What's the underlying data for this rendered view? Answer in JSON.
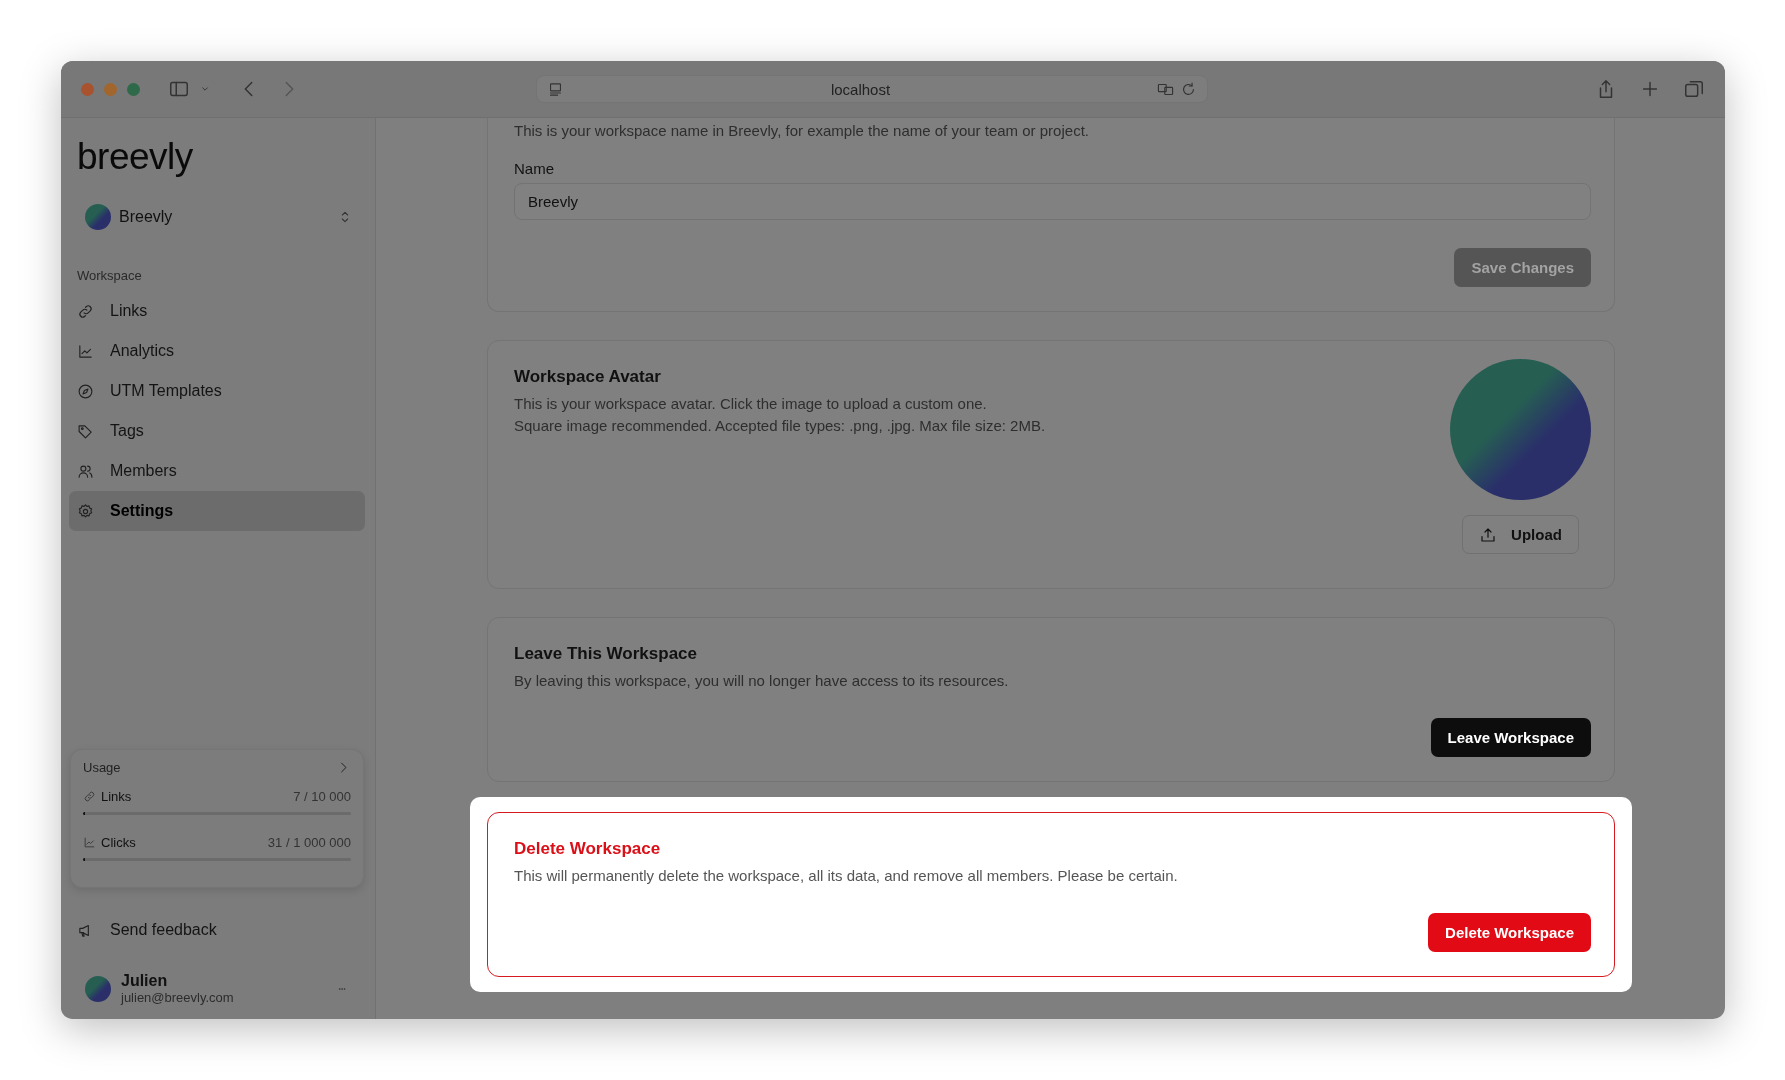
{
  "browser": {
    "url": "localhost"
  },
  "sidebar": {
    "logo": "breevly",
    "workspace": {
      "name": "Breevly"
    },
    "section_label": "Workspace",
    "items": [
      {
        "label": "Links",
        "selected": false
      },
      {
        "label": "Analytics",
        "selected": false
      },
      {
        "label": "UTM Templates",
        "selected": false
      },
      {
        "label": "Tags",
        "selected": false
      },
      {
        "label": "Members",
        "selected": false
      },
      {
        "label": "Settings",
        "selected": true
      }
    ],
    "usage": {
      "title": "Usage",
      "meters": [
        {
          "label": "Links",
          "reading": "7 / 10 000",
          "level": 0.0007
        },
        {
          "label": "Clicks",
          "reading": "31 / 1 000 000",
          "level": 3e-05
        }
      ]
    },
    "feedback": {
      "label": "Send feedback"
    },
    "user": {
      "name": "Julien",
      "email": "julien@breevly.com"
    }
  },
  "main": {
    "cards": [
      {
        "kind": "name_form",
        "highlighted": false,
        "description": "This is your workspace name in Breevly, for example the name of your team or project.",
        "field_label": "Name",
        "value": "Breevly",
        "button": {
          "label": "Save Changes",
          "disabled": true
        }
      },
      {
        "kind": "avatar",
        "highlighted": false,
        "title": "Workspace Avatar",
        "description_lines": [
          "This is your workspace avatar. Click the image to upload a custom one.",
          "Square image recommended. Accepted file types: .png, .jpg. Max file size: 2MB."
        ],
        "button": {
          "label": "Upload",
          "disabled": false
        }
      },
      {
        "kind": "action",
        "highlighted": false,
        "danger": false,
        "title": "Leave This Workspace",
        "description": "By leaving this workspace, you will no longer have access to its resources.",
        "button": {
          "label": "Leave Workspace",
          "disabled": false
        }
      },
      {
        "kind": "action",
        "highlighted": true,
        "danger": true,
        "title": "Delete Workspace",
        "description": "This will permanently delete the workspace, all its data, and remove all members. Please be certain.",
        "button": {
          "label": "Delete Workspace",
          "disabled": false
        }
      }
    ]
  }
}
